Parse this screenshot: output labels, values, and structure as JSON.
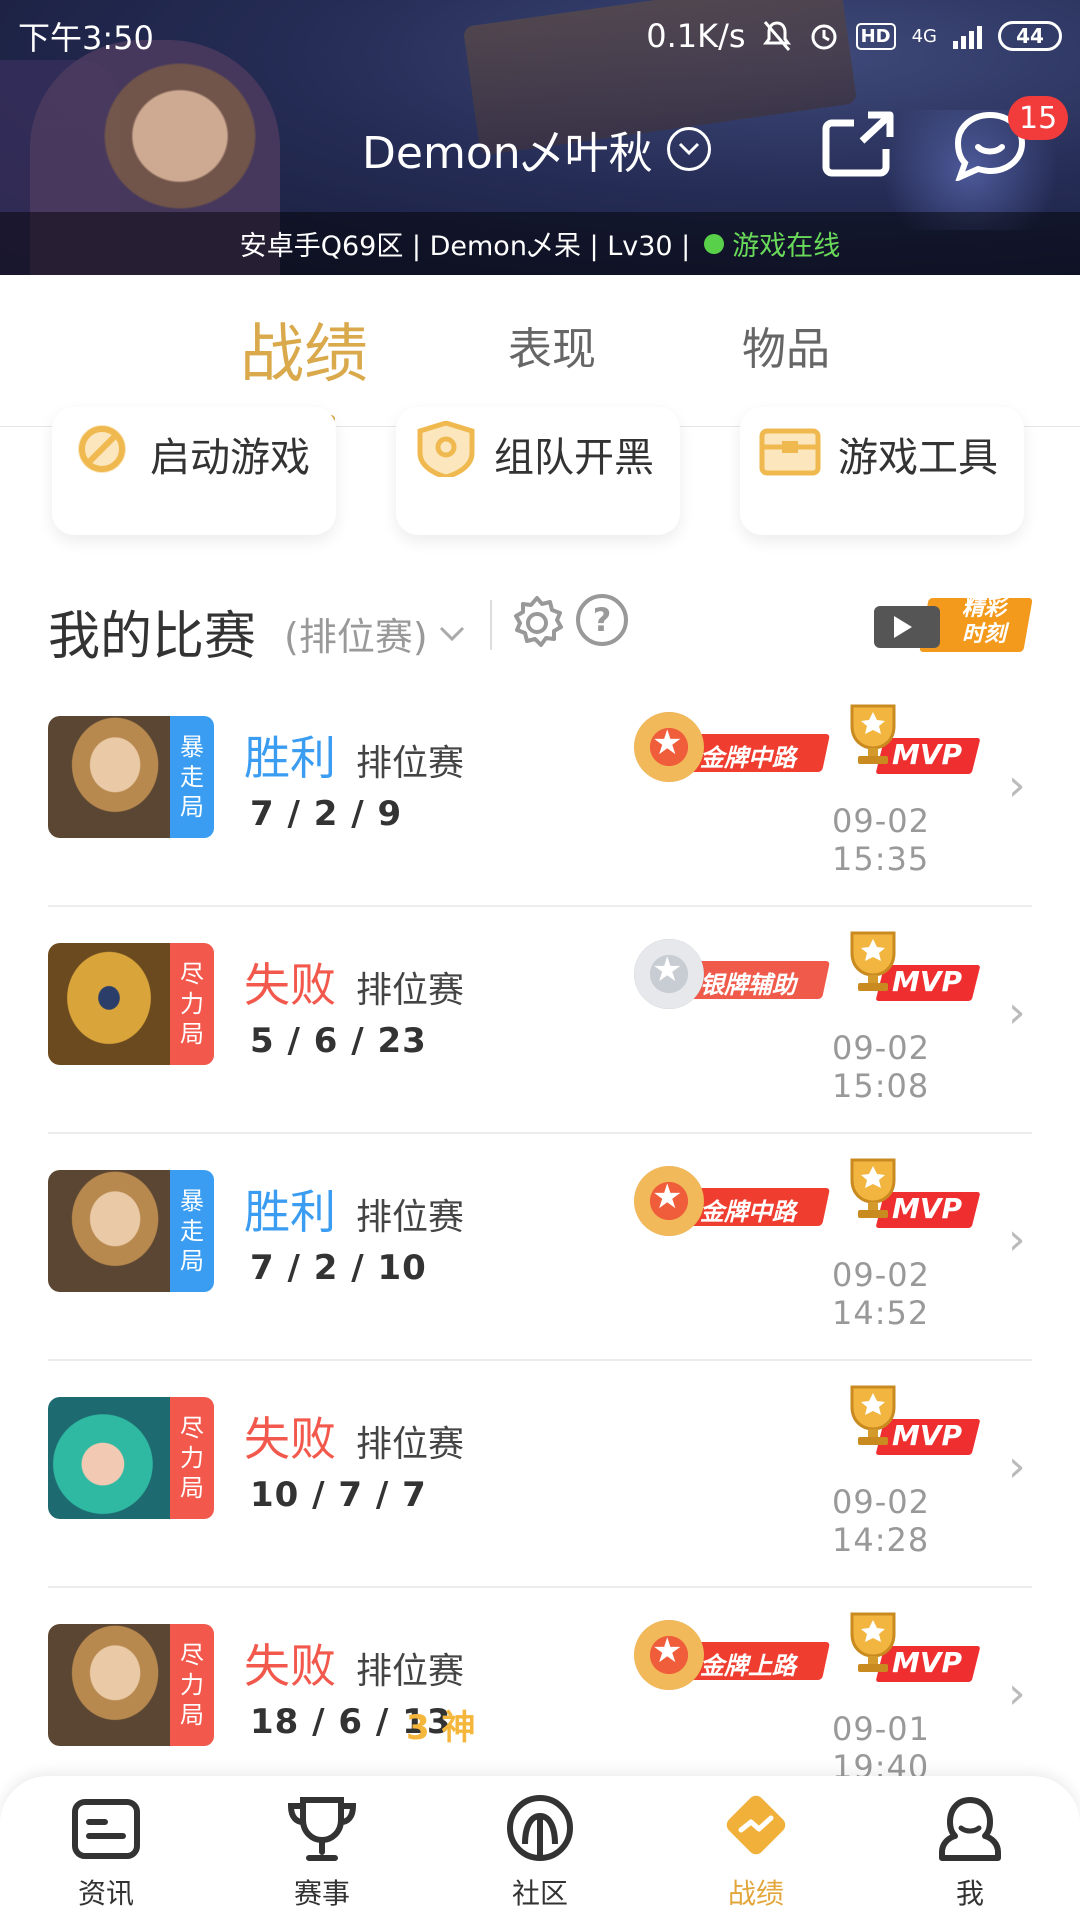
{
  "status_bar": {
    "time": "下午3:50",
    "speed": "0.1K/s",
    "hd": "HD",
    "net": "4G",
    "battery": "44"
  },
  "header": {
    "account_name": "Demon乄叶秋",
    "unread_count": "15",
    "info_line": "安卓手Q69区 | Demon乄呆 | Lv30 |",
    "online_status": "游戏在线"
  },
  "tabs": [
    {
      "label": "战绩",
      "active": true
    },
    {
      "label": "表现",
      "active": false
    },
    {
      "label": "物品",
      "active": false
    }
  ],
  "quick_actions": [
    {
      "label": "启动游戏",
      "icon": "launch-game-icon"
    },
    {
      "label": "组队开黑",
      "icon": "team-shield-icon"
    },
    {
      "label": "游戏工具",
      "icon": "toolbox-icon"
    }
  ],
  "section": {
    "title": "我的比赛",
    "filter": "(排位赛)",
    "highlights_line1": "精彩",
    "highlights_line2": "时刻"
  },
  "matches": [
    {
      "result": "胜利",
      "result_kind": "win",
      "mode_tag": [
        "暴",
        "走",
        "局"
      ],
      "tag_color": "#3a9df2",
      "type": "排位赛",
      "kda": "7 / 2 / 9",
      "extra": "",
      "medal": "金牌中路",
      "medal_kind": "gold",
      "mvp": "MVP",
      "time": "09-02 15:35",
      "hero_palette": "golden-knight"
    },
    {
      "result": "失败",
      "result_kind": "lose",
      "mode_tag": [
        "尽",
        "力",
        "局"
      ],
      "tag_color": "#f2584b",
      "type": "排位赛",
      "kda": "5 / 6 / 23",
      "extra": "",
      "medal": "银牌辅助",
      "medal_kind": "silver",
      "mvp": "MVP",
      "time": "09-02 15:08",
      "hero_palette": "golden-mask"
    },
    {
      "result": "胜利",
      "result_kind": "win",
      "mode_tag": [
        "暴",
        "走",
        "局"
      ],
      "tag_color": "#3a9df2",
      "type": "排位赛",
      "kda": "7 / 2 / 10",
      "extra": "",
      "medal": "金牌中路",
      "medal_kind": "gold",
      "mvp": "MVP",
      "time": "09-02 14:52",
      "hero_palette": "golden-knight"
    },
    {
      "result": "失败",
      "result_kind": "lose",
      "mode_tag": [
        "尽",
        "力",
        "局"
      ],
      "tag_color": "#f2584b",
      "type": "排位赛",
      "kda": "10 / 7 / 7",
      "extra": "",
      "medal": "",
      "medal_kind": "none",
      "mvp": "MVP",
      "time": "09-02 14:28",
      "hero_palette": "teal-hair"
    },
    {
      "result": "失败",
      "result_kind": "lose",
      "mode_tag": [
        "尽",
        "力",
        "局"
      ],
      "tag_color": "#f2584b",
      "type": "排位赛",
      "kda": "18 / 6 / 13",
      "extra": "3 神",
      "medal": "金牌上路",
      "medal_kind": "gold",
      "mvp": "MVP",
      "time": "09-01 19:40",
      "hero_palette": "golden-knight"
    }
  ],
  "bottom_nav": [
    {
      "label": "资讯",
      "icon": "news-icon",
      "active": false
    },
    {
      "label": "赛事",
      "icon": "trophy-icon",
      "active": false
    },
    {
      "label": "社区",
      "icon": "community-icon",
      "active": false
    },
    {
      "label": "战绩",
      "icon": "stats-icon",
      "active": true
    },
    {
      "label": "我",
      "icon": "profile-icon",
      "active": false
    }
  ],
  "colors": {
    "accent": "#d9a94b",
    "win": "#3a9df2",
    "lose": "#f2584b",
    "mvp_red": "#ef2f2f",
    "online": "#58d04a"
  }
}
